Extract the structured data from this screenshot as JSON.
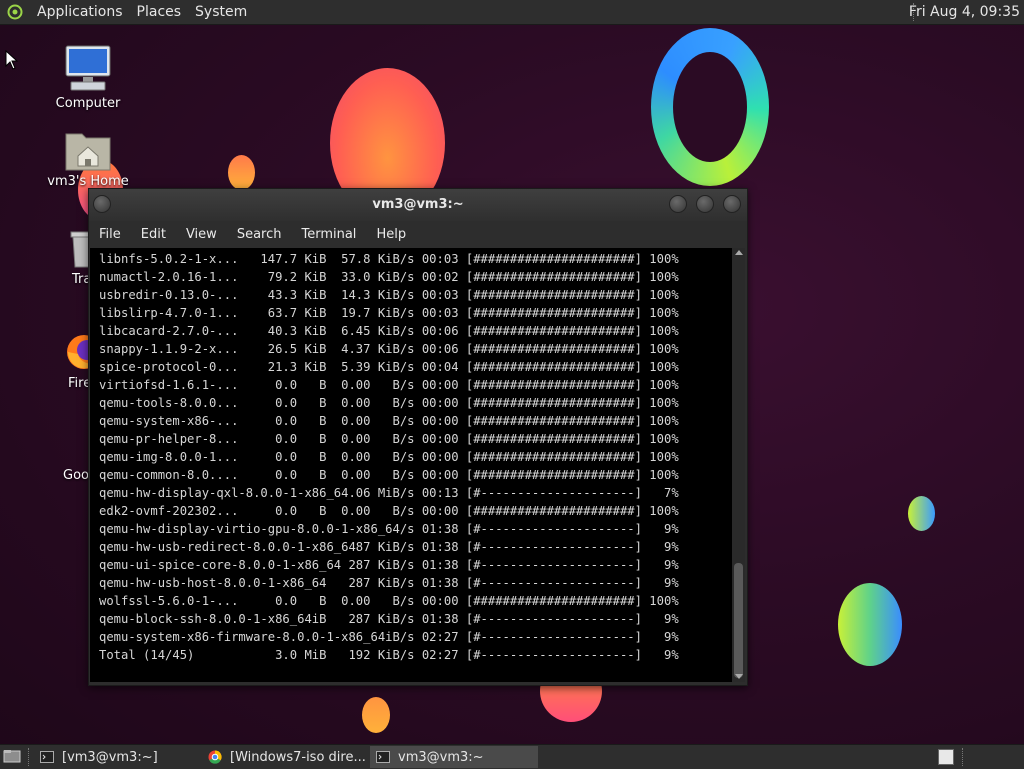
{
  "top_panel": {
    "menus": [
      "Applications",
      "Places",
      "System"
    ],
    "clock": "Fri Aug  4, 09:35"
  },
  "desktop": {
    "icons": [
      {
        "label": "Computer",
        "icon": "computer-icon"
      },
      {
        "label": "vm3's Home",
        "icon": "home-folder-icon"
      },
      {
        "label": "Tra",
        "icon": "trash-icon"
      },
      {
        "label": "Fire",
        "icon": "firefox-icon"
      },
      {
        "label": "Goo",
        "icon": "chrome-icon"
      }
    ]
  },
  "terminal": {
    "title": "vm3@vm3:~",
    "menus": [
      "File",
      "Edit",
      "View",
      "Search",
      "Terminal",
      "Help"
    ],
    "lines": [
      "libnfs-5.0.2-1-x...   147.7 KiB  57.8 KiB/s 00:03 [######################] 100%",
      "numactl-2.0.16-1...    79.2 KiB  33.0 KiB/s 00:02 [######################] 100%",
      "usbredir-0.13.0-...    43.3 KiB  14.3 KiB/s 00:03 [######################] 100%",
      "libslirp-4.7.0-1...    63.7 KiB  19.7 KiB/s 00:03 [######################] 100%",
      "libcacard-2.7.0-...    40.3 KiB  6.45 KiB/s 00:06 [######################] 100%",
      "snappy-1.1.9-2-x...    26.5 KiB  4.37 KiB/s 00:06 [######################] 100%",
      "spice-protocol-0...    21.3 KiB  5.39 KiB/s 00:04 [######################] 100%",
      "virtiofsd-1.6.1-...     0.0   B  0.00   B/s 00:00 [######################] 100%",
      "qemu-tools-8.0.0...     0.0   B  0.00   B/s 00:00 [######################] 100%",
      "qemu-system-x86-...     0.0   B  0.00   B/s 00:00 [######################] 100%",
      "qemu-pr-helper-8...     0.0   B  0.00   B/s 00:00 [######################] 100%",
      "qemu-img-8.0.0-1...     0.0   B  0.00   B/s 00:00 [######################] 100%",
      "qemu-common-8.0....     0.0   B  0.00   B/s 00:00 [######################] 100%",
      "qemu-hw-display-qxl-8.0.0-1-x86_64.06 MiB/s 00:13 [#---------------------]   7%",
      "edk2-ovmf-202302...     0.0   B  0.00   B/s 00:00 [######################] 100%",
      "qemu-hw-display-virtio-gpu-8.0.0-1-x86_64/s 01:38 [#---------------------]   9%",
      "qemu-hw-usb-redirect-8.0.0-1-x86_6487 KiB/s 01:38 [#---------------------]   9%",
      "qemu-ui-spice-core-8.0.0-1-x86_64 287 KiB/s 01:38 [#---------------------]   9%",
      "qemu-hw-usb-host-8.0.0-1-x86_64   287 KiB/s 01:38 [#---------------------]   9%",
      "wolfssl-5.6.0-1-...     0.0   B  0.00   B/s 00:00 [######################] 100%",
      "qemu-block-ssh-8.0.0-1-x86_64iB   287 KiB/s 01:38 [#---------------------]   9%",
      "qemu-system-x86-firmware-8.0.0-1-x86_64iB/s 02:27 [#---------------------]   9%",
      "Total (14/45)           3.0 MiB   192 KiB/s 02:27 [#---------------------]   9%"
    ]
  },
  "taskbar": {
    "tasks": [
      {
        "label": "[vm3@vm3:~]",
        "icon": "terminal-icon",
        "active": false
      },
      {
        "label": "[Windows7-iso dire...",
        "icon": "chrome-icon",
        "active": false
      },
      {
        "label": "vm3@vm3:~",
        "icon": "terminal-icon",
        "active": true
      }
    ]
  }
}
